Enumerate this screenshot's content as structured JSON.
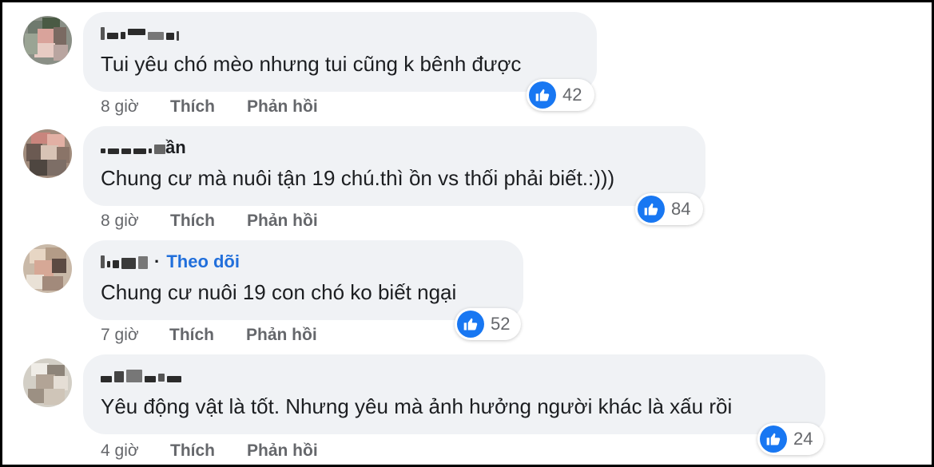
{
  "colors": {
    "bubble": "#f0f2f5",
    "text": "#1c1e21",
    "meta": "#65676b",
    "link": "#216fdb",
    "like": "#1877f2"
  },
  "actions": {
    "like_label": "Thích",
    "reply_label": "Phản hồi"
  },
  "comments": [
    {
      "author_suffix": "",
      "follow_label": "",
      "text": "Tui yêu chó mèo nhưng tui cũng k bênh được",
      "reaction_icon": "thumbs-up-icon",
      "reaction_count": "42",
      "time": "8 giờ"
    },
    {
      "author_suffix": "ần",
      "follow_label": "",
      "text": "Chung cư mà nuôi tận 19 chú.thì ồn vs thối phải biết.:)))",
      "reaction_icon": "thumbs-up-icon",
      "reaction_count": "84",
      "time": "8 giờ"
    },
    {
      "author_suffix": "",
      "follow_label": "Theo dõi",
      "text": "Chung cư nuôi 19 con chó ko biết ngại",
      "reaction_icon": "thumbs-up-icon",
      "reaction_count": "52",
      "time": "7 giờ"
    },
    {
      "author_suffix": "",
      "follow_label": "",
      "text": "Yêu động vật là tốt. Nhưng yêu mà ảnh hưởng người khác là xấu rồi",
      "reaction_icon": "thumbs-up-icon",
      "reaction_count": "24",
      "time": "4 giờ"
    }
  ]
}
